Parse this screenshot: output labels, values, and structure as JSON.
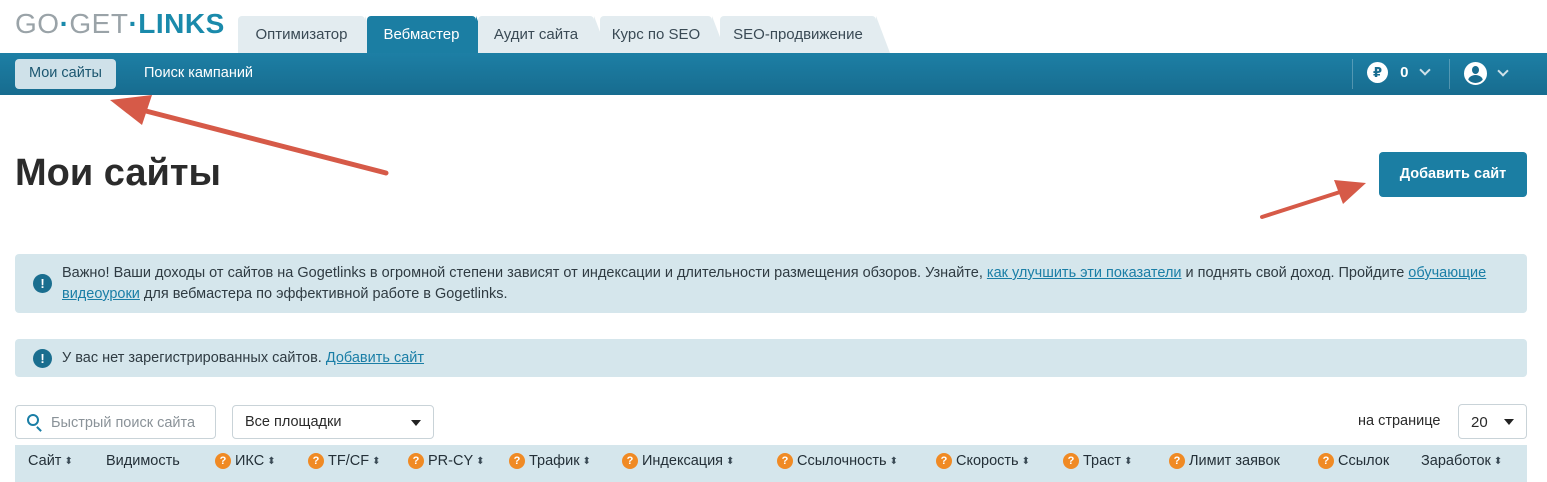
{
  "logo": {
    "go": "GO",
    "dot1": "·",
    "get": "GET",
    "dot2": "·",
    "links": "LINKS"
  },
  "tabs": [
    {
      "label": "Оптимизатор",
      "active": false
    },
    {
      "label": "Вебмастер",
      "active": true
    },
    {
      "label": "Аудит сайта",
      "active": false
    },
    {
      "label": "Курс по SEO",
      "active": false
    },
    {
      "label": "SEO-продвижение",
      "active": false
    }
  ],
  "nav": {
    "items": [
      {
        "label": "Мои сайты",
        "active": true
      },
      {
        "label": "Поиск кампаний",
        "active": false
      }
    ],
    "balance": {
      "currency_symbol": "₽",
      "value": "0"
    }
  },
  "page": {
    "title": "Мои сайты",
    "add_button": "Добавить сайт"
  },
  "alerts": {
    "info_symbol": "!",
    "notice": {
      "text1": "Важно! Ваши доходы от сайтов на Gogetlinks в огромной степени зависят от индексации и длительности размещения обзоров. Узнайте, ",
      "link1": "как улучшить эти показатели",
      "text2": " и поднять свой доход. Пройдите ",
      "link2": "обучающие видеоуроки",
      "text3": " для вебмастера по эффективной работе в Gogetlinks."
    },
    "empty": {
      "text": "У вас нет зарегистрированных сайтов. ",
      "link": "Добавить сайт"
    }
  },
  "filters": {
    "search_placeholder": "Быстрый поиск сайта",
    "platform_select": "Все площадки",
    "per_page_label": "на странице",
    "per_page_value": "20"
  },
  "table": {
    "help_symbol": "?",
    "sort_symbol": "⬍",
    "columns": [
      {
        "label": "Сайт",
        "help": false,
        "sortable": true
      },
      {
        "label": "Видимость",
        "help": false,
        "sortable": false
      },
      {
        "label": "ИКС",
        "help": true,
        "sortable": true
      },
      {
        "label": "TF/CF",
        "help": true,
        "sortable": true
      },
      {
        "label": "PR-CY",
        "help": true,
        "sortable": true
      },
      {
        "label": "Трафик",
        "help": true,
        "sortable": true
      },
      {
        "label": "Индексация",
        "help": true,
        "sortable": true
      },
      {
        "label": "Ссылочность",
        "help": true,
        "sortable": true
      },
      {
        "label": "Скорость",
        "help": true,
        "sortable": true
      },
      {
        "label": "Траст",
        "help": true,
        "sortable": true
      },
      {
        "label": "Лимит заявок",
        "help": true,
        "sortable": false
      },
      {
        "label": "Ссылок",
        "help": true,
        "sortable": false
      },
      {
        "label": "Заработок",
        "help": false,
        "sortable": true
      }
    ]
  },
  "colors": {
    "brand": "#1b7ea3",
    "annotation_arrow": "#d65a48",
    "help_badge": "#f08a24",
    "alert_bg": "#d5e6ec"
  }
}
